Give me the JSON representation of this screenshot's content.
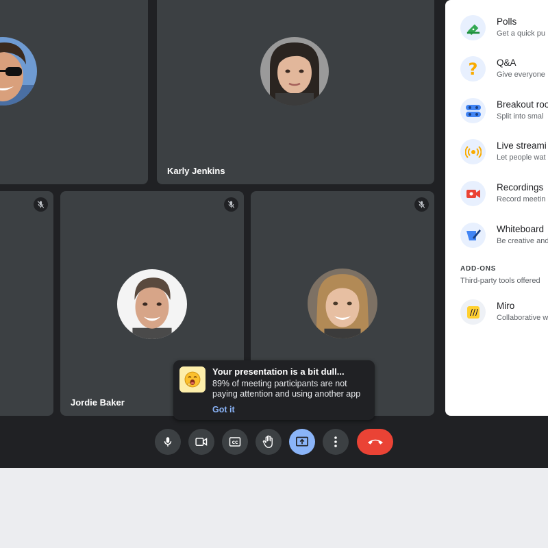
{
  "tiles": [
    {
      "name": ""
    },
    {
      "name": "Karly Jenkins"
    },
    {
      "name": ""
    },
    {
      "name": "Jordie Baker"
    },
    {
      "name": ""
    }
  ],
  "side_panel": {
    "activities": [
      {
        "title": "Polls",
        "subtitle": "Get a quick pu",
        "icon": "polls-icon"
      },
      {
        "title": "Q&A",
        "subtitle": "Give everyone",
        "icon": "question-icon"
      },
      {
        "title": "Breakout roo",
        "subtitle": "Split into smal",
        "icon": "breakout-rooms-icon"
      },
      {
        "title": "Live streami",
        "subtitle": "Let people wat",
        "icon": "live-stream-icon"
      },
      {
        "title": "Recordings",
        "subtitle": "Record meetin",
        "icon": "recording-icon"
      },
      {
        "title": "Whiteboard",
        "subtitle": "Be creative and",
        "icon": "whiteboard-icon"
      }
    ],
    "addons_header": "ADD-ONS",
    "addons_sub": "Third-party tools offered",
    "addons": [
      {
        "title": "Miro",
        "subtitle": "Collaborative w",
        "icon": "miro-icon"
      }
    ]
  },
  "toast": {
    "title": "Your presentation is a bit dull...",
    "body": "89% of meeting participants are not paying attention and using another app",
    "action": "Got it",
    "emoji": "yawning-face-icon"
  },
  "controls": [
    "microphone-icon",
    "camera-icon",
    "captions-icon",
    "raise-hand-icon",
    "present-screen-icon",
    "more-options-icon",
    "end-call-icon"
  ],
  "colors": {
    "accent": "#8ab4f8",
    "end_call": "#ea4335",
    "tile": "#3c4043",
    "background": "#202124"
  }
}
